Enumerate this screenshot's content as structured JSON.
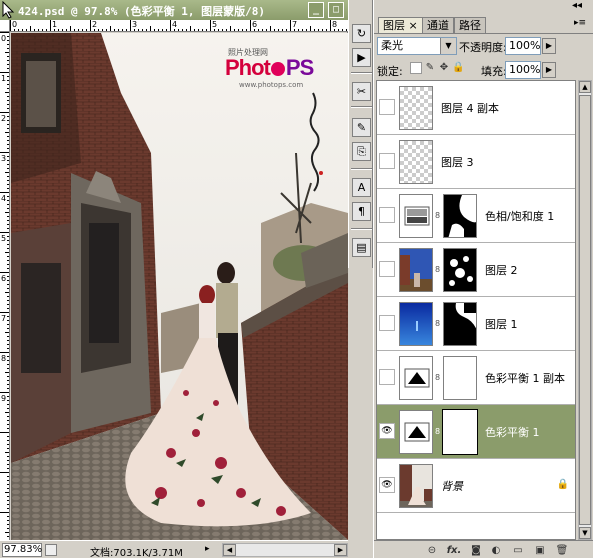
{
  "document": {
    "title": "424.psd @ 97.8% (色彩平衡 1, 图层蒙版/8)",
    "minimize_label": "_",
    "maximize_label": "□",
    "ruler_top_labels": [
      "0",
      "1",
      "2",
      "3",
      "4",
      "5",
      "6",
      "7",
      "8",
      "9"
    ],
    "ruler_left_labels": [
      "0",
      "1",
      "2",
      "3",
      "4",
      "5",
      "6",
      "7",
      "8",
      "9"
    ],
    "logo": {
      "small_text": "照片处理网",
      "main_text_part1": "Phot",
      "main_text_part2": "PS",
      "sub_text": "www.photops.com"
    },
    "status": {
      "zoom": "97.83%",
      "doc_size": "文档:703.1K/3.71M"
    }
  },
  "toolstrip": {
    "tools": [
      "history-icon",
      "play-icon",
      "tool-options-icon",
      "brush-icon",
      "clone-source-icon",
      "character-icon",
      "paragraph-icon",
      "layer-comps-icon"
    ]
  },
  "panel": {
    "tabs": [
      {
        "label": "图层",
        "close": "×",
        "active": true
      },
      {
        "label": "通道",
        "active": false
      },
      {
        "label": "路径",
        "active": false
      }
    ],
    "menu_icon": "▸≡",
    "blend_mode": "柔光",
    "opacity_label": "不透明度:",
    "opacity_value": "100%",
    "lock_label": "锁定:",
    "fill_label": "填充:",
    "fill_value": "100%",
    "layers": [
      {
        "name": "图层 4 副本",
        "visible": false,
        "kind": "transparent",
        "selected": false
      },
      {
        "name": "图层 3",
        "visible": false,
        "kind": "transparent",
        "selected": false
      },
      {
        "name": "色相/饱和度 1",
        "visible": false,
        "kind": "adjustment-hue",
        "selected": false
      },
      {
        "name": "图层 2",
        "visible": false,
        "kind": "photo-mask",
        "selected": false
      },
      {
        "name": "图层 1",
        "visible": false,
        "kind": "blue-mask",
        "selected": false
      },
      {
        "name": "色彩平衡 1 副本",
        "visible": false,
        "kind": "adjustment-balance",
        "selected": false
      },
      {
        "name": "色彩平衡 1",
        "visible": true,
        "kind": "adjustment-balance",
        "selected": true
      },
      {
        "name": "背景",
        "visible": true,
        "kind": "background",
        "selected": false
      }
    ],
    "bottom_icons": [
      "link-layers-icon",
      "fx-icon",
      "add-mask-icon",
      "adjustment-icon",
      "new-group-icon",
      "new-layer-icon",
      "trash-icon"
    ],
    "bottom_icon_glyphs": [
      "⊝",
      "fx.",
      "◙",
      "◐",
      "▭",
      "▣",
      "🗑"
    ]
  },
  "colors": {
    "title_green": "#8b9c6b",
    "selected_layer": "#8b9c6b",
    "chrome": "#d4d0c8"
  }
}
